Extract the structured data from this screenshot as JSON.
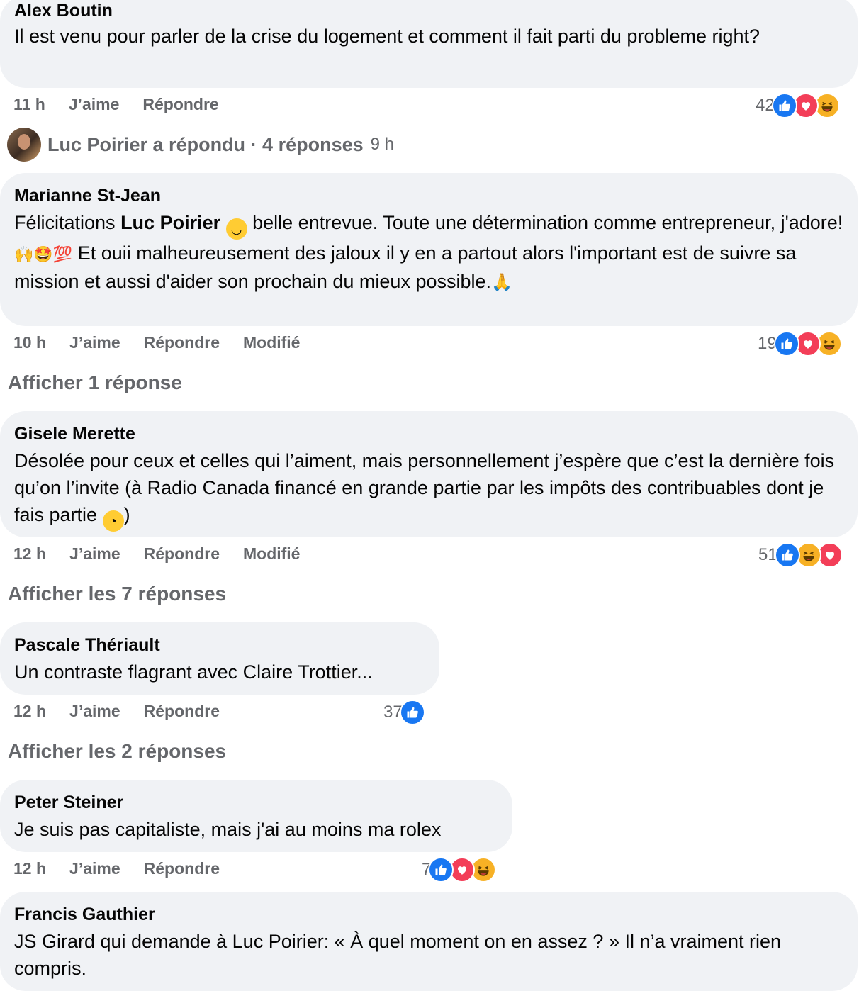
{
  "reply_summary": {
    "name_action": "Luc Poirier a répondu",
    "separator": " · ",
    "count": "4 réponses",
    "time": "9 h"
  },
  "comments": [
    {
      "author": "Alex Boutin",
      "text": "Il est venu pour parler de la crise du logement et comment il fait parti du probleme right?",
      "time": "11 h",
      "like": "J’aime",
      "reply": "Répondre",
      "reaction_count": "42",
      "reactions": [
        "like-icon",
        "love-icon",
        "haha-icon"
      ]
    },
    {
      "author": "Marianne St-Jean",
      "text_pre": "Félicitations ",
      "mention": "Luc Poirier",
      "text_mid": " belle entrevue. Toute une détermination comme entrepreneur, j'adore! ",
      "emojis_inline": "🙌🤩💯",
      "text_post": " Et ouii malheureusement des jaloux il y en a partout alors l'important est de suivre sa mission et aussi d'aider son prochain du mieux possible.",
      "emoji_end": "🙏",
      "time": "10 h",
      "like": "J’aime",
      "reply": "Répondre",
      "edited": "Modifié",
      "reaction_count": "19",
      "reactions": [
        "like-icon",
        "love-icon",
        "haha-icon"
      ],
      "show_replies": "Afficher 1 réponse"
    },
    {
      "author": "Gisele Merette",
      "text": "Désolée pour ceux et celles qui l’aiment, mais personnellement j’espère que c’est la dernière fois qu’on l’invite (à Radio Canada financé en grande partie par les impôts des contribuables dont je fais partie ",
      "text_end": ")",
      "time": "12 h",
      "like": "J’aime",
      "reply": "Répondre",
      "edited": "Modifié",
      "reaction_count": "51",
      "reactions": [
        "like-icon",
        "haha-icon",
        "love-icon"
      ],
      "show_replies": "Afficher les 7 réponses"
    },
    {
      "author": "Pascale Thériault",
      "text": "Un contraste flagrant avec Claire Trottier...",
      "time": "12 h",
      "like": "J’aime",
      "reply": "Répondre",
      "reaction_count": "37",
      "reactions": [
        "like-icon"
      ],
      "show_replies": "Afficher les 2 réponses"
    },
    {
      "author": "Peter Steiner",
      "text": "Je suis pas capitaliste, mais j'ai au moins ma rolex",
      "time": "12 h",
      "like": "J’aime",
      "reply": "Répondre",
      "reaction_count": "7",
      "reactions": [
        "like-icon",
        "love-icon",
        "haha-icon"
      ]
    },
    {
      "author": "Francis Gauthier",
      "text": "JS Girard qui demande à Luc Poirier: « À quel moment on en assez ? » Il n’a vraiment rien compris."
    }
  ],
  "colors": {
    "bubble": "#f0f2f5",
    "secondary_text": "#65676b",
    "like_blue": "#1877f2",
    "love_red": "#f33e58",
    "haha_yellow": "#f7b125"
  }
}
